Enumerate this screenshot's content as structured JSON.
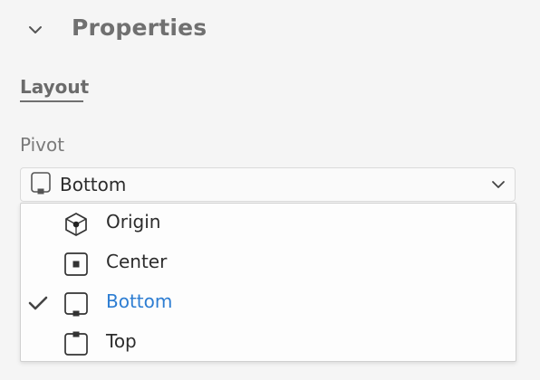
{
  "panel": {
    "title": "Properties",
    "collapse_icon": "chevron-down-icon"
  },
  "section": {
    "tab_label": "Layout"
  },
  "pivot": {
    "label": "Pivot",
    "selected_value": "Bottom",
    "selected_icon": "pivot-bottom-icon",
    "dropdown_icon": "chevron-down-icon",
    "options": [
      {
        "label": "Origin",
        "icon": "pivot-origin-icon",
        "checked": false
      },
      {
        "label": "Center",
        "icon": "pivot-center-icon",
        "checked": false
      },
      {
        "label": "Bottom",
        "icon": "pivot-bottom-icon",
        "checked": true
      },
      {
        "label": "Top",
        "icon": "pivot-top-icon",
        "checked": false
      }
    ]
  },
  "colors": {
    "selected_text": "#2d7dd2",
    "panel_background": "#f5f5f5",
    "title_text": "#707070"
  }
}
